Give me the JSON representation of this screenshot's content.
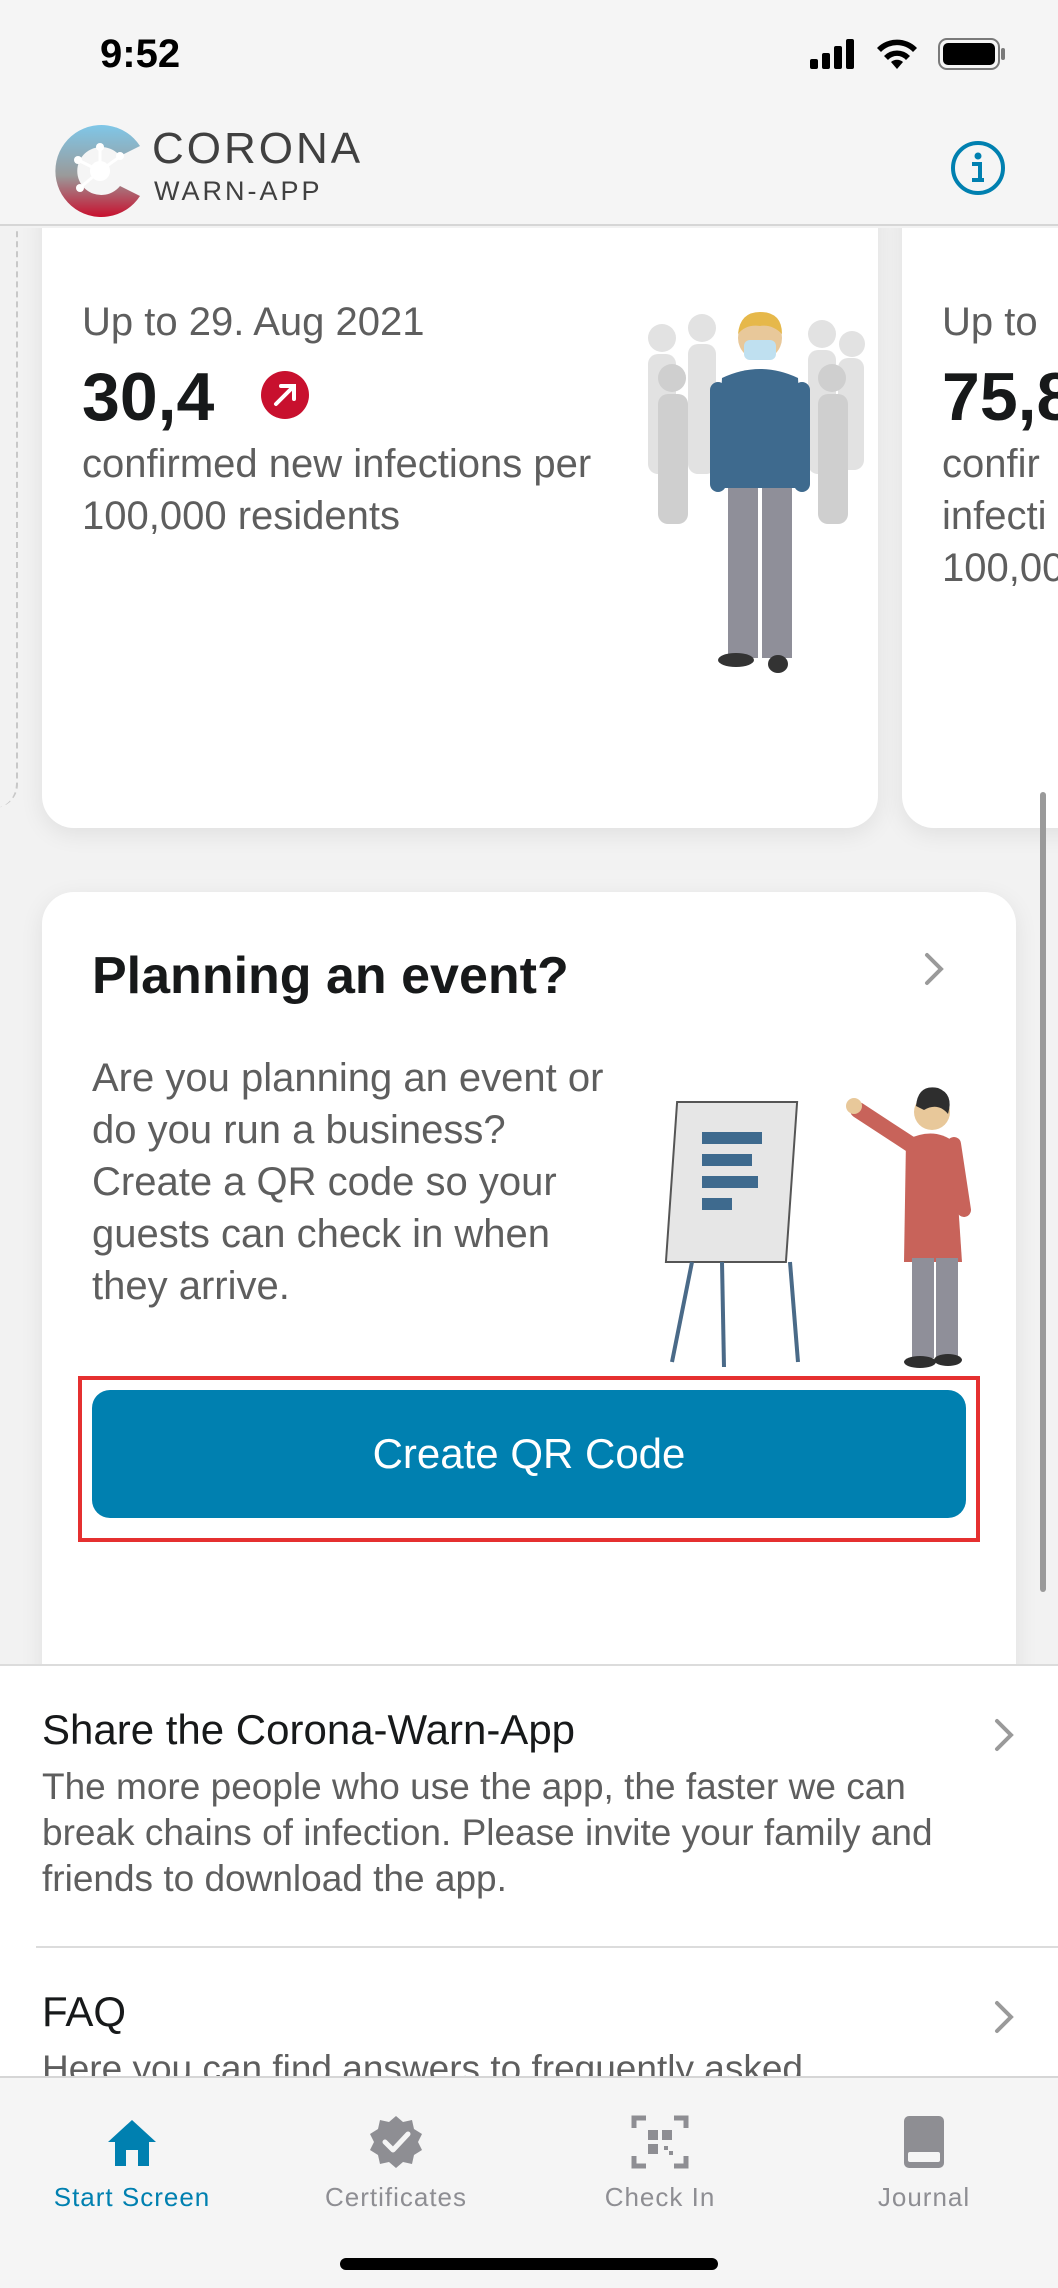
{
  "status_bar": {
    "time": "9:52"
  },
  "header": {
    "logo_line1": "CORONA",
    "logo_line2": "WARN-APP",
    "info_icon": "info-icon"
  },
  "stats": {
    "card1": {
      "date": "Up to 29. Aug 2021",
      "value": "30,4",
      "trend": "up-right-arrow-icon",
      "description": "confirmed new infections per 100,000 residents"
    },
    "card2": {
      "date": "Up to",
      "value": "75,8",
      "description_lines": [
        "confir",
        "infecti",
        "100,00"
      ]
    }
  },
  "event_card": {
    "title": "Planning an event?",
    "text": "Are you planning an event or do you run a business? Create a QR code so your guests can check in when they arrive.",
    "button_label": "Create QR Code"
  },
  "list": {
    "share": {
      "title": "Share the Corona-Warn-App",
      "description": "The more people who use the app, the faster we can break chains of infection. Please invite your family and friends to download the app."
    },
    "faq": {
      "title": "FAQ",
      "description": "Here you can find answers to frequently asked"
    }
  },
  "tabs": [
    {
      "label": "Start Screen",
      "icon": "home-icon",
      "active": true
    },
    {
      "label": "Certificates",
      "icon": "certificate-badge-icon",
      "active": false
    },
    {
      "label": "Check In",
      "icon": "qr-scan-icon",
      "active": false
    },
    {
      "label": "Journal",
      "icon": "book-icon",
      "active": false
    }
  ],
  "colors": {
    "accent": "#0080b0",
    "highlight": "#e53030",
    "trend_red": "#c8102e"
  }
}
